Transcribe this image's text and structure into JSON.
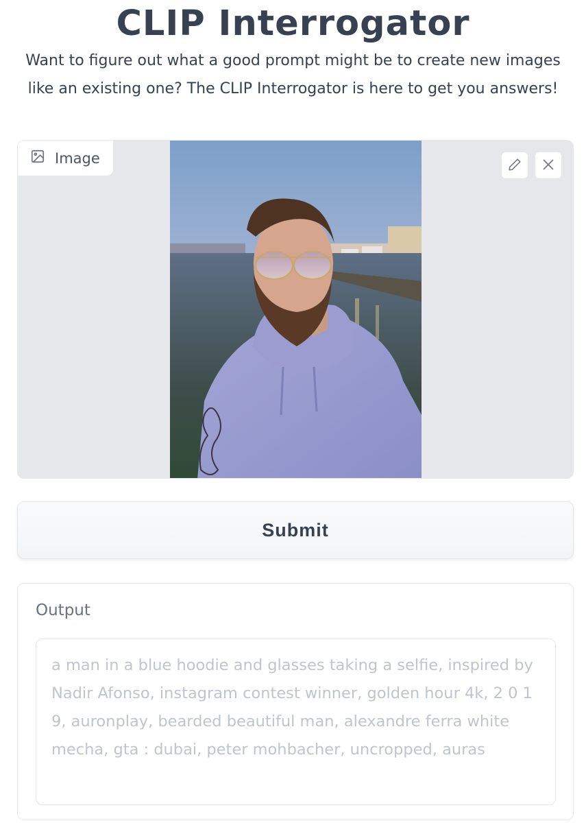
{
  "header": {
    "title": "CLIP Interrogator",
    "subtitle": "Want to figure out what a good prompt might be to create new images like an existing one? The CLIP Interrogator is here to get you answers!"
  },
  "image_input": {
    "label": "Image",
    "label_icon": "image-icon",
    "edit_icon": "pencil-icon",
    "clear_icon": "close-icon"
  },
  "submit": {
    "label": "Submit"
  },
  "output": {
    "label": "Output",
    "value": "a man in a blue hoodie and glasses taking a selfie, inspired by Nadir Afonso, instagram contest winner, golden hour 4k, 2 0 1 9, auronplay, bearded beautiful man, alexandre ferra white mecha, gta : dubai, peter mohbacher, uncropped, auras"
  },
  "colors": {
    "panel_bg": "#e5e7eb",
    "text": "#374151",
    "output_text": "#c0c4cc"
  }
}
